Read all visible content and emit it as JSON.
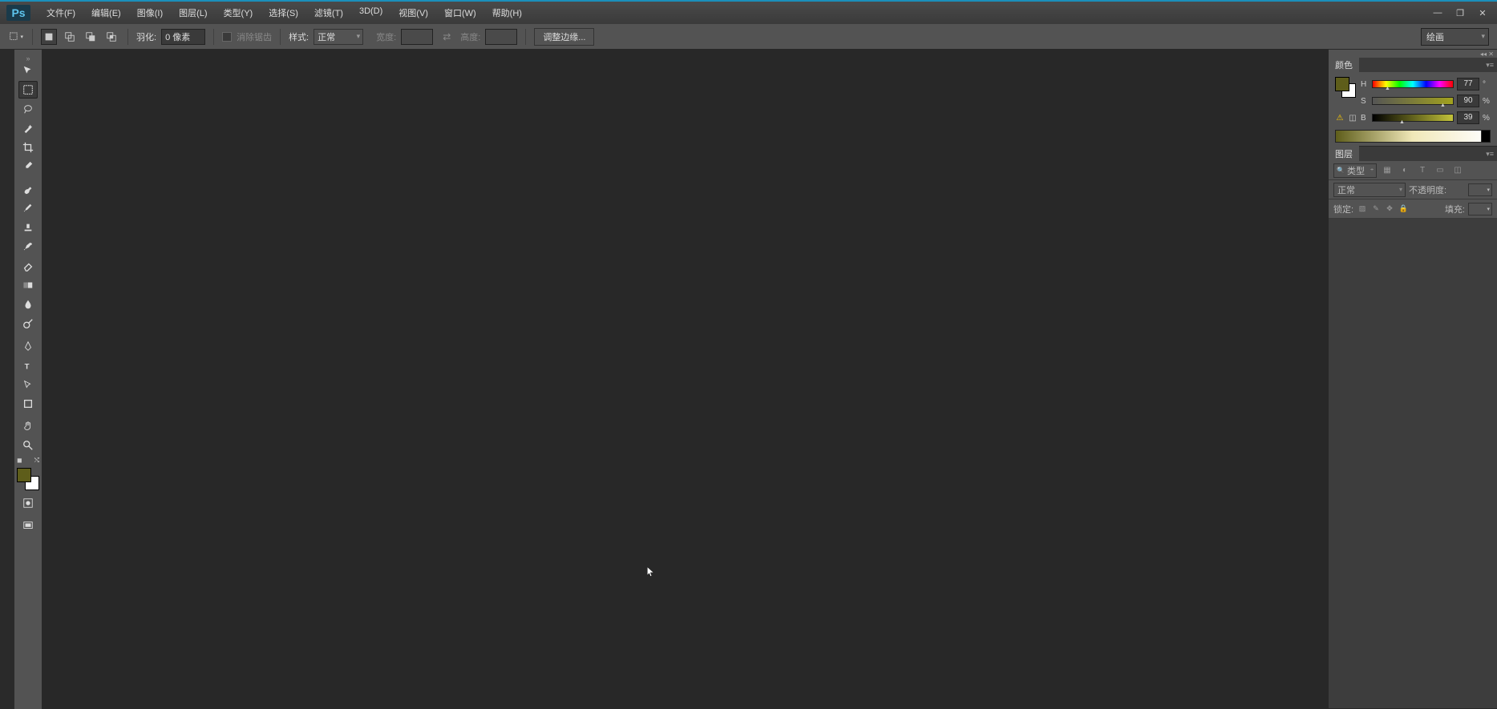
{
  "menu": {
    "file": "文件(F)",
    "edit": "编辑(E)",
    "image": "图像(I)",
    "layer": "图层(L)",
    "type": "类型(Y)",
    "select": "选择(S)",
    "filter": "滤镜(T)",
    "threed": "3D(D)",
    "view": "视图(V)",
    "window": "窗口(W)",
    "help": "帮助(H)"
  },
  "options": {
    "feather_label": "羽化:",
    "feather_value": "0 像素",
    "antialias_label": "消除锯齿",
    "style_label": "样式:",
    "style_value": "正常",
    "width_label": "宽度:",
    "height_label": "高度:",
    "refine_edge": "调整边缘..."
  },
  "workspace": "绘画",
  "color_panel": {
    "title": "颜色",
    "h_label": "H",
    "h_value": "77",
    "h_unit": "°",
    "s_label": "S",
    "s_value": "90",
    "s_unit": "%",
    "b_label": "B",
    "b_value": "39",
    "b_unit": "%"
  },
  "layers_panel": {
    "title": "图层",
    "filter_label": "类型",
    "blend_mode": "正常",
    "opacity_label": "不透明度:",
    "lock_label": "锁定:",
    "fill_label": "填充:"
  },
  "colors": {
    "foreground": "#5e5d1a",
    "background": "#ffffff"
  }
}
